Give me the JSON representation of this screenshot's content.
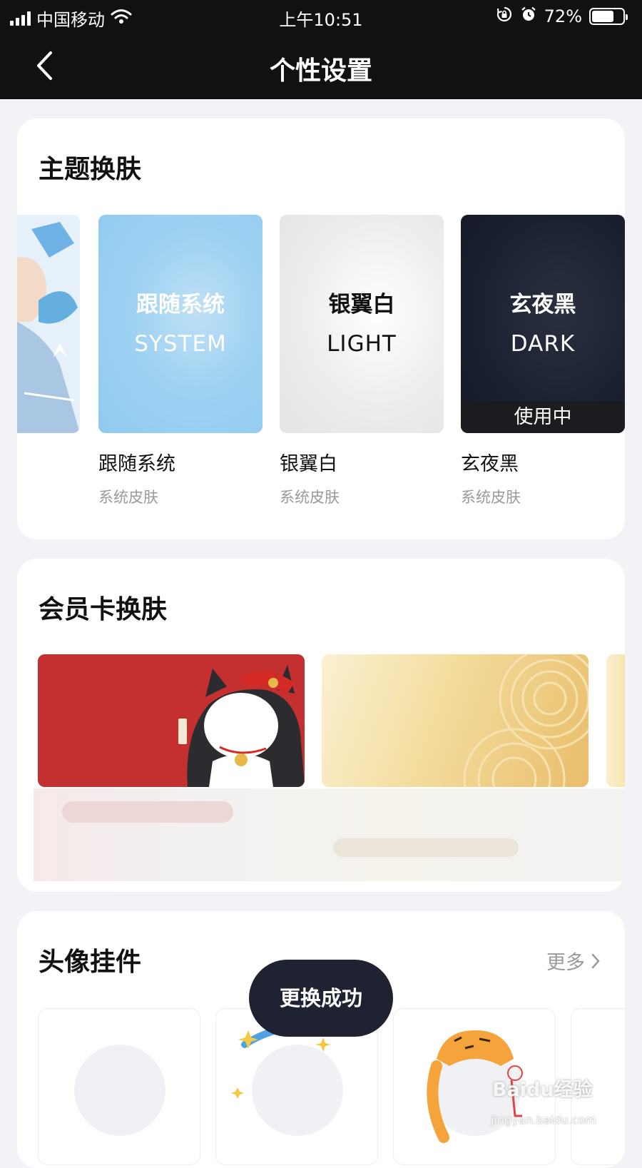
{
  "status_bar": {
    "carrier": "中国移动",
    "time": "上午10:51",
    "battery_percent": "72%",
    "battery_level": 0.72
  },
  "nav": {
    "title": "个性设置"
  },
  "theme_section": {
    "title": "主题换肤",
    "skins": [
      {
        "title_cn": "跟随系统",
        "title_en": "SYSTEM",
        "name": "跟随系统",
        "sub": "系统皮肤"
      },
      {
        "title_cn": "银翼白",
        "title_en": "LIGHT",
        "name": "银翼白",
        "sub": "系统皮肤"
      },
      {
        "title_cn": "玄夜黑",
        "title_en": "DARK",
        "name": "玄夜黑",
        "sub": "系统皮肤",
        "badge": "使用中"
      }
    ]
  },
  "member_section": {
    "title": "会员卡换肤"
  },
  "avatar_section": {
    "title": "头像挂件",
    "more_label": "更多"
  },
  "toast": {
    "text": "更换成功"
  },
  "watermark": {
    "brand": "Baidu经验",
    "url": "jingyan.baidu.com"
  },
  "colors": {
    "nav_background": "#111111",
    "page_background": "#f2f3f7",
    "toast_background": "#1f2231",
    "system_skin": "#9fd2f2",
    "dark_skin": "#1b2030",
    "red_card": "#c4302f",
    "gold_card": "#f3dc9c"
  }
}
